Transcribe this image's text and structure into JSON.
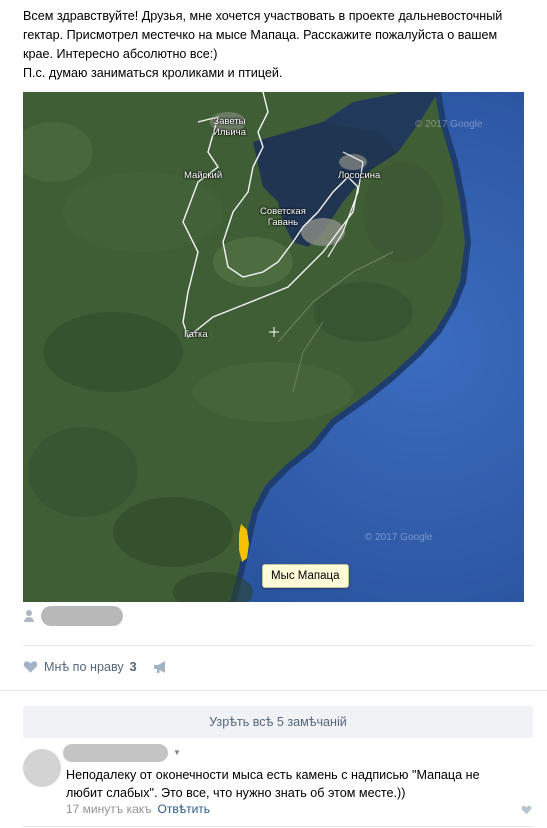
{
  "post": {
    "text_lines": [
      "Всем здравствуйте! Друзья, мне хочется участвовать в проекте дальневосточный",
      "гектар. Присмотрел местечко на мысе Мапаца. Расскажите пожалуйста о вашем",
      "крае. Интересно абсолютно все:)",
      "П.с. думаю заниматься кроликами и птицей."
    ]
  },
  "map": {
    "labels": {
      "zavety": "Заветы\nИльича",
      "maysky": "Майский",
      "lososina": "Лососина",
      "sovgavan": "Советская\nГавань",
      "gatka": "Гатка"
    },
    "watermark_top": "© 2017 Google",
    "watermark_bottom": "© 2017 Google",
    "tooltip": "Мыс Мапаца",
    "colors": {
      "sea": "#2d5aa8",
      "land": "#3c5a33",
      "marker": "#f2c200"
    }
  },
  "actions": {
    "like_label": "Мнѣ по нраву",
    "like_count": "3"
  },
  "comments_section": {
    "show_all_label": "Узрѣть всѣ 5 замѣчаній",
    "comment": {
      "text_lines": [
        "Неподалеку от оконечности мыса есть камень с надписью \"Мапаца не",
        "любит слабых\". Это все, что нужно знать об этом месте.))"
      ],
      "time": "17 минутъ какъ",
      "reply_label": "Отвѣтить"
    }
  }
}
